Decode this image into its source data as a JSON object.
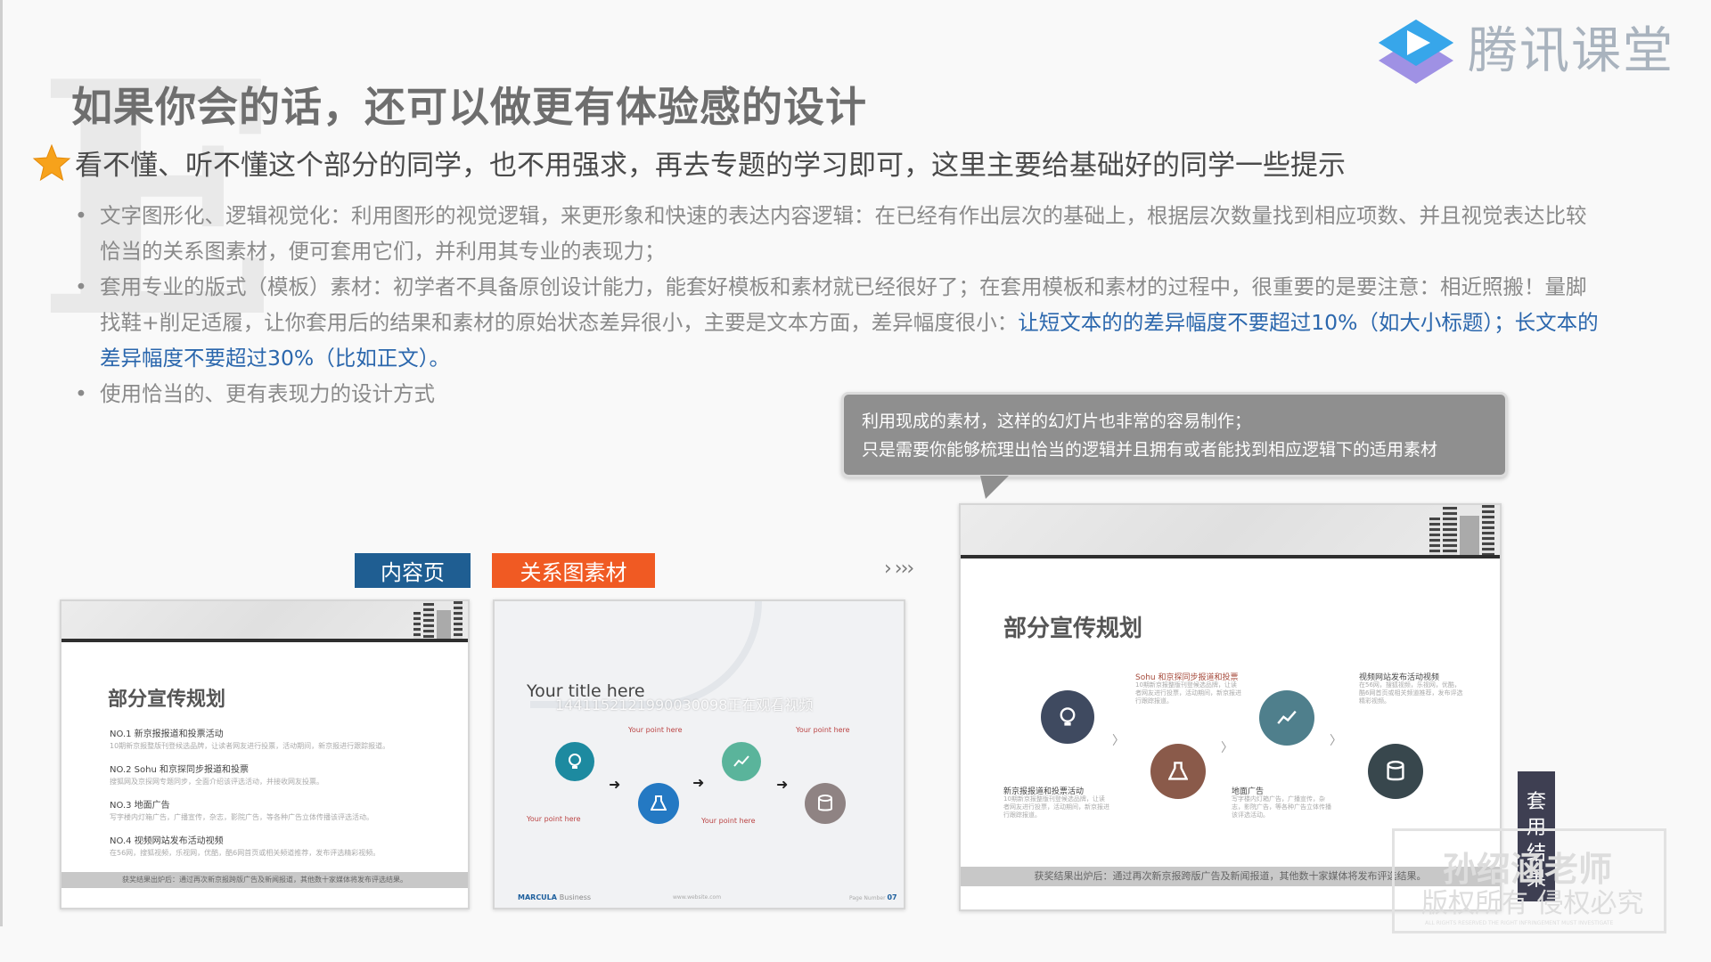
{
  "brand": {
    "name": "腾讯课堂"
  },
  "title": "如果你会的话，还可以做更有体验感的设计",
  "subtitle": "看不懂、听不懂这个部分的同学，也不用强求，再去专题的学习即可，这里主要给基础好的同学一些提示",
  "bullets": {
    "b1": "文字图形化、逻辑视觉化：利用图形的视觉逻辑，来更形象和快速的表达内容逻辑：在已经有作出层次的基础上，根据层次数量找到相应项数、并且视觉表达比较恰当的关系图素材，便可套用它们，并利用其专业的表现力；",
    "b2_text": "套用专业的版式（模板）素材：初学者不具备原创设计能力，能套好模板和素材就已经很好了；在套用模板和素材的过程中，很重要的是要注意：相近照搬！量脚找鞋+削足适履，让你套用后的结果和素材的原始状态差异很小，主要是文本方面，差异幅度很小：",
    "b2_highlight": "让短文本的的差异幅度不要超过10%（如大小标题）；长文本的差异幅度不要超过30%（比如正文）。",
    "b3": "使用恰当的、更有表现力的设计方式"
  },
  "callout": {
    "line1": "利用现成的素材，这样的幻灯片也非常的容易制作；",
    "line2": "只是需要你能够梳理出恰当的逻辑并且拥有或者能找到相应逻辑下的适用素材"
  },
  "tags": {
    "content_page": "内容页",
    "diagram_material": "关系图素材"
  },
  "arrows": "› ›››",
  "card_content": {
    "title": "部分宣传规划",
    "items": [
      {
        "head": "NO.1  新京报报道和投票活动",
        "sub": "10期新京报整版刊登候选品牌，让读者网友进行投票，活动期间，新京报进行跟踪报道。"
      },
      {
        "head": "NO.2  Sohu 和京探同步报道和投票",
        "sub": "搜狐网及京探网专题同步，全面介绍该评选活动，并接收网友投票。"
      },
      {
        "head": "NO.3  地面广告",
        "sub": "写字楼内灯箱广告，广播宣传，杂志，影院广告，等各种广告立体传播该评选活动。"
      },
      {
        "head": "NO.4  视频网站发布活动视频",
        "sub": "在56网，搜狐视频，乐视网，优酷，酷6网首页或相关频道推荐，发布评选精彩视频。"
      }
    ],
    "footer": "获奖结果出炉后：通过再次新京报跨版广告及新闻报道，其他数十家媒体将发布评选结果。"
  },
  "card_diagram": {
    "title": "Your title here",
    "overlay": "1441152121990030098正在观看视频",
    "point": "Your point here",
    "brand": "MARCULA",
    "brand_sub": "Business",
    "site": "www.website.com",
    "page_label": "Page Number",
    "page_num": "07"
  },
  "card_result": {
    "title": "部分宣传规划",
    "labels": {
      "sohu": "Sohu 和京探同步报道和投票",
      "video": "视频网站发布活动视频",
      "xjb": "新京报报道和投票活动",
      "ground": "地面广告"
    },
    "footer": "获奖结果出炉后：通过再次新京报跨版广告及新闻报道，其他数十家媒体将发布评选结果。"
  },
  "result_label": "套用结果",
  "watermark": {
    "line1": "孙绍涵老师",
    "line2": "版权所有 侵权必究",
    "line3": "ALL RIGHTS RESERVED THE RIGHT INFRINGEMENT MUST INVESTIGATE"
  }
}
